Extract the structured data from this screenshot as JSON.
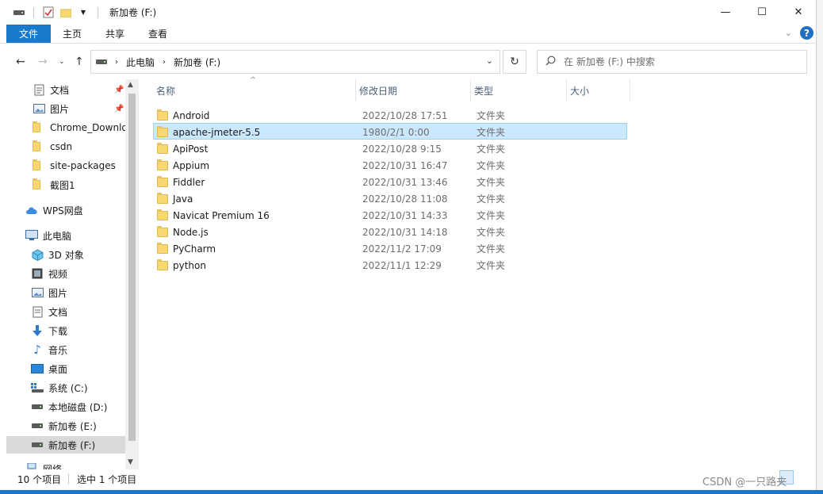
{
  "window": {
    "title": "新加卷 (F:)",
    "controls": {
      "minimize": "—",
      "maximize": "☐",
      "close": "✕"
    }
  },
  "ribbon": {
    "tabs": [
      {
        "label": "文件"
      },
      {
        "label": "主页"
      },
      {
        "label": "共享"
      },
      {
        "label": "查看"
      }
    ],
    "help": "?"
  },
  "address": {
    "breadcrumb": [
      "此电脑",
      "新加卷 (F:)"
    ],
    "search_placeholder": "在 新加卷 (F:) 中搜索"
  },
  "nav": {
    "quick_access": [
      {
        "label": "文档",
        "icon": "document-icon",
        "pinned": true
      },
      {
        "label": "图片",
        "icon": "pictures-icon",
        "pinned": true
      },
      {
        "label": "Chrome_Downloads",
        "icon": "folder-icon",
        "pinned": false
      },
      {
        "label": "csdn",
        "icon": "folder-icon",
        "pinned": false
      },
      {
        "label": "site-packages",
        "icon": "folder-icon",
        "pinned": false
      },
      {
        "label": "截图1",
        "icon": "folder-icon",
        "pinned": false
      }
    ],
    "wps": {
      "label": "WPS网盘",
      "icon": "cloud-icon"
    },
    "this_pc": {
      "label": "此电脑",
      "icon": "computer-icon"
    },
    "pc_items": [
      {
        "label": "3D 对象",
        "icon": "cube-icon"
      },
      {
        "label": "视频",
        "icon": "video-icon"
      },
      {
        "label": "图片",
        "icon": "pictures-icon"
      },
      {
        "label": "文档",
        "icon": "document-icon"
      },
      {
        "label": "下载",
        "icon": "download-icon"
      },
      {
        "label": "音乐",
        "icon": "music-icon"
      },
      {
        "label": "桌面",
        "icon": "desktop-icon"
      },
      {
        "label": "系统 (C:)",
        "icon": "system-drive-icon"
      },
      {
        "label": "本地磁盘 (D:)",
        "icon": "drive-icon"
      },
      {
        "label": "新加卷 (E:)",
        "icon": "drive-icon"
      },
      {
        "label": "新加卷 (F:)",
        "icon": "drive-icon",
        "selected": true
      },
      {
        "label": "网络",
        "icon": "network-icon"
      }
    ]
  },
  "columns": {
    "name": "名称",
    "date": "修改日期",
    "type": "类型",
    "size": "大小"
  },
  "files": [
    {
      "name": "Android",
      "date": "2022/10/28 17:51",
      "type": "文件夹"
    },
    {
      "name": "apache-jmeter-5.5",
      "date": "1980/2/1 0:00",
      "type": "文件夹",
      "selected": true
    },
    {
      "name": "ApiPost",
      "date": "2022/10/28 9:15",
      "type": "文件夹"
    },
    {
      "name": "Appium",
      "date": "2022/10/31 16:47",
      "type": "文件夹"
    },
    {
      "name": "Fiddler",
      "date": "2022/10/31 13:46",
      "type": "文件夹"
    },
    {
      "name": "Java",
      "date": "2022/10/28 11:08",
      "type": "文件夹"
    },
    {
      "name": "Navicat Premium 16",
      "date": "2022/10/31 14:33",
      "type": "文件夹"
    },
    {
      "name": "Node.js",
      "date": "2022/10/31 14:18",
      "type": "文件夹"
    },
    {
      "name": "PyCharm",
      "date": "2022/11/2 17:09",
      "type": "文件夹"
    },
    {
      "name": "python",
      "date": "2022/11/1 12:29",
      "type": "文件夹"
    }
  ],
  "status": {
    "count": "10 个项目",
    "selection": "选中 1 个项目"
  },
  "watermark": "CSDN @一只路夹"
}
